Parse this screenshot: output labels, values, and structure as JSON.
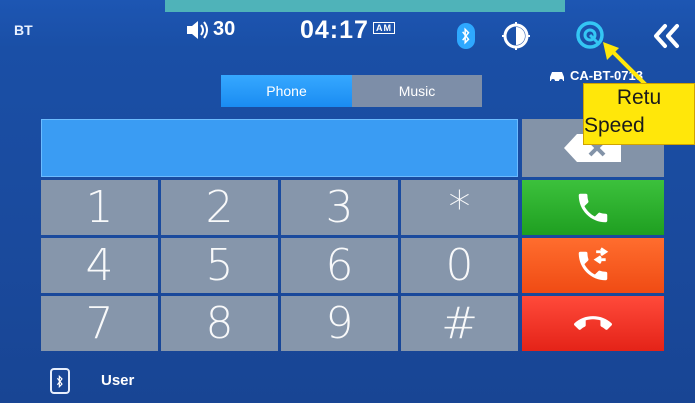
{
  "status": {
    "source_tag": "BT",
    "volume": "30",
    "time": "04:17",
    "ampm": "AM"
  },
  "device": {
    "name": "CA-BT-0713"
  },
  "tabs": [
    {
      "label": "Phone",
      "active": true
    },
    {
      "label": "Music",
      "active": false
    }
  ],
  "dial_display": {
    "value": ""
  },
  "keypad": {
    "keys": [
      "1",
      "2",
      "3",
      "*",
      "4",
      "5",
      "6",
      "0",
      "7",
      "8",
      "9",
      "#"
    ]
  },
  "bottom": {
    "user_label": "User"
  },
  "callout": {
    "line1": "Retu",
    "line2": "Speed"
  },
  "colors": {
    "background": "#1a4fa6",
    "active_tab": "#1a8cf2",
    "answer": "#2fb12f",
    "transfer": "#f35a1c",
    "hangup": "#ea2f22",
    "callout": "#ffe70a",
    "bluetooth": "#2ea8ff"
  },
  "icons": {
    "volume": "speaker-icon",
    "bluetooth": "bluetooth-icon",
    "brightness": "brightness-icon",
    "speed_dial": "speed-dial-icon",
    "back": "double-chevron-left-icon",
    "backspace": "backspace-icon",
    "answer": "phone-answer-icon",
    "transfer": "call-transfer-icon",
    "hangup": "phone-hangup-icon",
    "phone_device": "phone-device-icon",
    "car": "car-icon"
  }
}
